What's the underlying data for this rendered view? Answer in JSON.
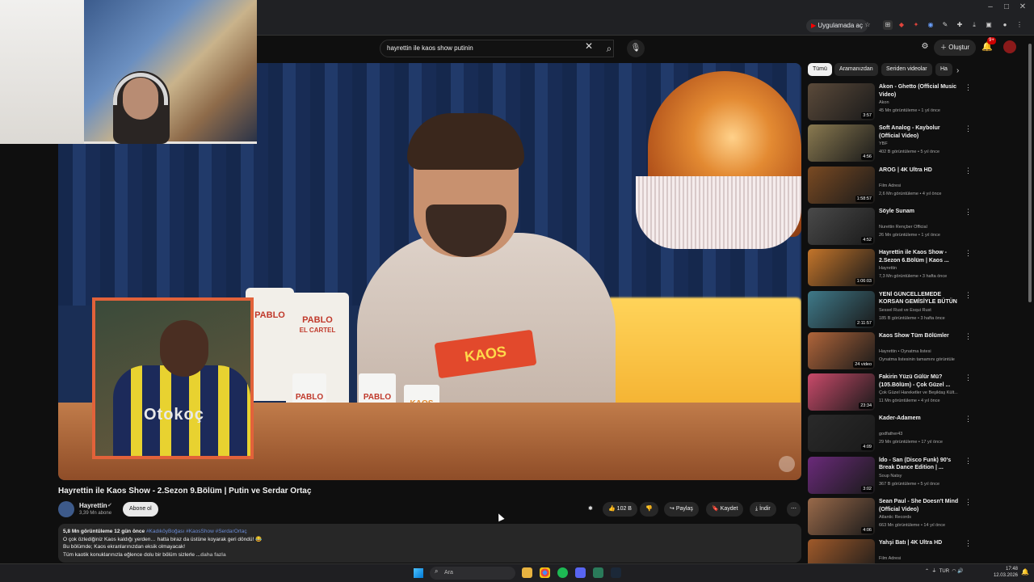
{
  "browser": {
    "open_in_app": "Uygulamada aç"
  },
  "youtube": {
    "search_query": "hayrettin ile kaos show putinin",
    "create_label": "Oluştur",
    "notification_count": "9+"
  },
  "video": {
    "title": "Hayrettin ile Kaos Show - 2.Sezon 9.Bölüm | Putin ve Serdar Ortaç",
    "channel_name": "Hayrettin",
    "subscribers": "3,39 Mn abone",
    "subscribe_label": "Abone ol",
    "likes": "102 B",
    "share_label": "Paylaş",
    "save_label": "Kaydet",
    "download_label": "İndir",
    "card_text": "KAOS",
    "shirt_text": "Otokoç",
    "bag_text_1": "PABLO",
    "bag_text_2": "PABLO",
    "bag_sub_2": "EL CARTEL",
    "cup_text": "PABLO",
    "description": {
      "meta": "5,8 Mn görüntüleme  12 gün önce",
      "tags": "#KadıköyBoğası #KaosShow #SerdarOrtaç",
      "line1": "O çok özlediğiniz Kaos kaldığı yerden… hatta biraz da üstüne koyarak geri döndü! 😂",
      "line2": "Bu bölümde; Kaos ekranlarınızdan eksik olmayacak!",
      "line3": "Tüm kaotik konuklarınızla eğlence dolu bir bölüm sizlerle",
      "more": " ...daha fazla"
    }
  },
  "chips": [
    "Tümü",
    "Aramanızdan",
    "Seriden videolar",
    "Ha"
  ],
  "recommendations": [
    {
      "title": "Akon - Ghetto (Official Music Video)",
      "channel": "Akon",
      "meta": "45 Mn görüntüleme • 1 yıl önce",
      "duration": "3:57",
      "color": "#5b4a3a"
    },
    {
      "title": "Soft Analog - Kaybolur (Official Video)",
      "channel": "YBF",
      "meta": "402 B görüntüleme • 5 yıl önce",
      "duration": "4:56",
      "color": "#8a7a50"
    },
    {
      "title": "AROG | 4K Ultra HD",
      "channel": "Film Adresi",
      "meta": "2,6 Mn görüntüleme • 4 yıl önce",
      "duration": "1:58:57",
      "color": "#7a4a22"
    },
    {
      "title": "Söyle Sunam",
      "channel": "Nurettin Rençber Official",
      "meta": "26 Mn görüntüleme • 1 yıl önce",
      "duration": "4:52",
      "color": "#4a4a4a"
    },
    {
      "title": "Hayrettin ile Kaos Show - 2.Sezon 6.Bölüm | Kaos ...",
      "channel": "Hayrettin",
      "meta": "7,3 Mn görüntüleme • 3 hafta önce",
      "duration": "1:06:03",
      "color": "#c4752a"
    },
    {
      "title": "YENİ GÜNCELLEMEDE KORSAN GEMİSİYLE BÜTÜN DENİZİ EL...",
      "channel": "Sessel Rust ve Esqui Rust",
      "meta": "185 B görüntüleme • 3 hafta önce",
      "duration": "2:11:57",
      "color": "#3f7a8a"
    },
    {
      "title": "Kaos Show Tüm Bölümler",
      "channel": "Hayrettin • Oynatma listesi",
      "meta": "Oynatma listesinin tamamını görüntüle",
      "duration": "24 video",
      "color": "#b0653a"
    },
    {
      "title": "Fakirin Yüzü Gülür Mü? (105.Bölüm) - Çok Güzel ...",
      "channel": "Çok Güzel Hareketler ve Beşiktaş Kült...",
      "meta": "11 Mn görüntüleme • 4 yıl önce",
      "duration": "23:34",
      "color": "#c94a6a"
    },
    {
      "title": "Kader-Adamem",
      "channel": "godfather43",
      "meta": "29 Mn görüntüleme • 17 yıl önce",
      "duration": "4:09",
      "color": "#2a2a2a"
    },
    {
      "title": "İdo - San (Disco Funk) 90's Break Dance Edition | ...",
      "channel": "Soup Natsy",
      "meta": "367 B görüntüleme • 5 yıl önce",
      "duration": "3:02",
      "color": "#6a2a7a"
    },
    {
      "title": "Sean Paul - She Doesn't Mind (Official Video)",
      "channel": "Atlantic Records",
      "meta": "663 Mn görüntüleme • 14 yıl önce",
      "duration": "4:06",
      "color": "#9a6a4a"
    },
    {
      "title": "Yahşi Batı | 4K Ultra HD",
      "channel": "Film Adresi",
      "meta": "",
      "duration": "",
      "color": "#a05a2a"
    }
  ],
  "taskbar": {
    "search_placeholder": "Ara",
    "lang": "TUR",
    "time": "17:48",
    "date": "12.03.2026"
  }
}
